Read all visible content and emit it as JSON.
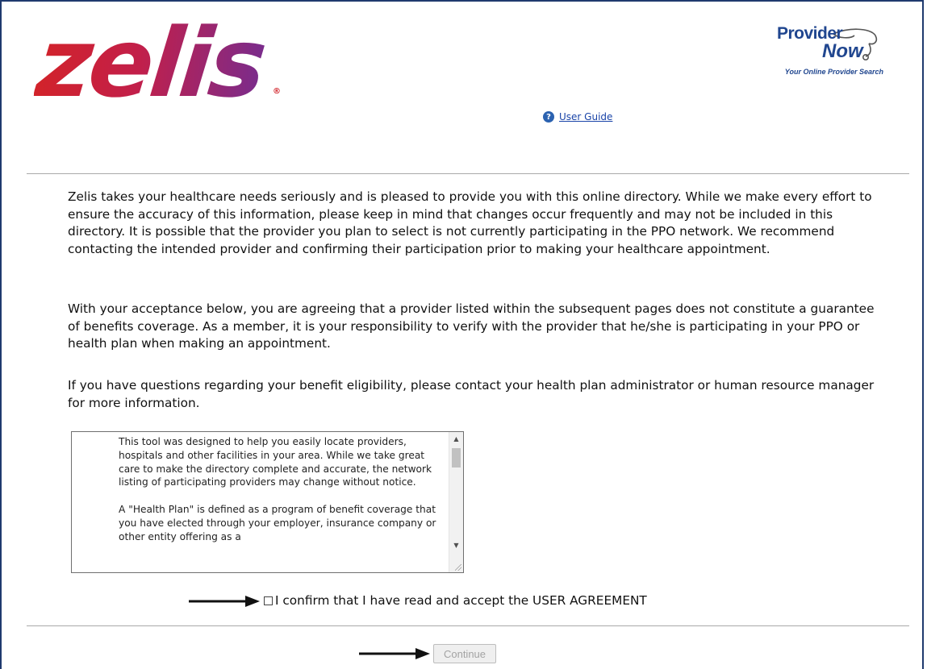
{
  "header": {
    "logo_text": "zelis",
    "registered_mark": "®",
    "provider_now": {
      "provider": "Provider",
      "now": "Now",
      "tagline": "Your Online Provider Search"
    },
    "user_guide": {
      "icon": "help-icon",
      "label": "User Guide"
    }
  },
  "disclaimer": {
    "paragraphs": [
      "Zelis takes your healthcare needs seriously and is pleased to provide you with this online directory. While we make every effort to ensure the accuracy of this information, please keep in mind that changes occur frequently and may not be included in this directory. It is possible that the provider you plan to select is not currently participating in the PPO network. We recommend contacting the intended provider and confirming their participation prior to making your healthcare appointment.",
      "With your acceptance below, you are agreeing that a provider listed within the subsequent pages does not constitute a guarantee of benefits coverage. As a member, it is your responsibility to verify with the provider that he/she is participating in your PPO or health plan when making an appointment.",
      "If you have questions regarding your benefit eligibility, please contact your health plan administrator or human resource manager for more information."
    ]
  },
  "agreement": {
    "text": "This tool was designed to help you easily locate providers, hospitals and other facilities in your area. While we take great care to make the directory complete and accurate, the network listing of participating providers may change without notice.\n\nA \"Health Plan\" is defined as a program of benefit coverage that you have elected through your employer, insurance company or other entity offering as a",
    "confirm_label": "I confirm that I have read and accept the USER AGREEMENT",
    "confirm_checked": false
  },
  "actions": {
    "continue_label": "Continue",
    "continue_enabled": false
  },
  "colors": {
    "logo_red": "#d2232a",
    "logo_purple": "#7a2c8c",
    "provider_now_blue": "#20468f",
    "link_blue": "#1a44a8"
  }
}
